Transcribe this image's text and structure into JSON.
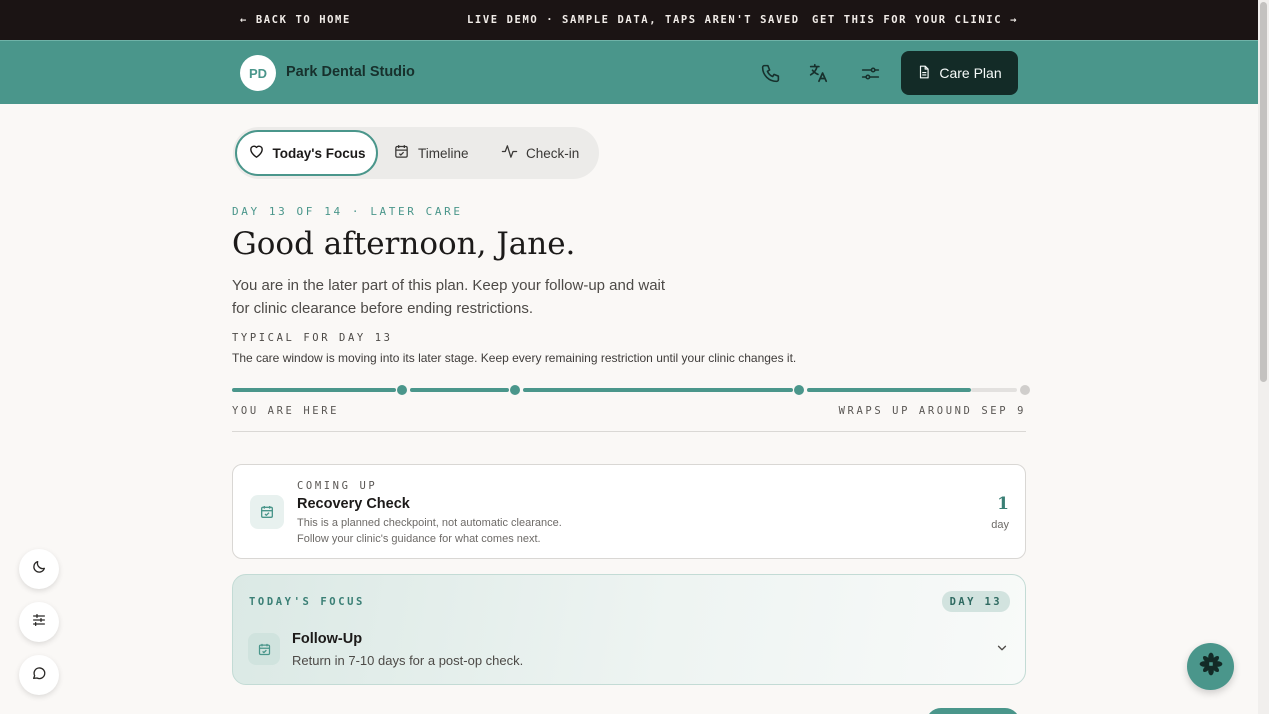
{
  "demo_bar": {
    "back_label": "← BACK TO HOME",
    "live_label": "LIVE DEMO · SAMPLE DATA, TAPS AREN'T SAVED",
    "get_label": "GET THIS FOR YOUR CLINIC →"
  },
  "header": {
    "initials": "PD",
    "clinic_name": "Park Dental Studio",
    "icons": [
      "phone-icon",
      "translate-icon",
      "settings-sliders-icon"
    ],
    "care_plan_label": "Care Plan"
  },
  "tabs": [
    {
      "label": "Today's Focus",
      "icon": "heart-icon",
      "active": true
    },
    {
      "label": "Timeline",
      "icon": "calendar-icon",
      "active": false
    },
    {
      "label": "Check-in",
      "icon": "activity-icon",
      "active": false
    }
  ],
  "greeting": {
    "eyebrow": "DAY 13 OF 14 · LATER CARE",
    "title": "Good afternoon, Jane.",
    "intro": "You are in the later part of this plan. Keep your follow-up and wait for clinic clearance before ending restrictions.",
    "typical_label": "TYPICAL FOR DAY 13",
    "typical_text": "The care window is moving into its later stage. Keep every remaining restriction until your clinic changes it."
  },
  "progress": {
    "current_day": 13,
    "total_days": 14,
    "left_label": "YOU ARE HERE",
    "right_label": "WRAPS UP AROUND SEP 9"
  },
  "coming_up": {
    "label": "COMING UP",
    "title": "Recovery Check",
    "desc_line1": "This is a planned checkpoint, not automatic clearance.",
    "desc_line2": "Follow your clinic's guidance for what comes next.",
    "count": "1",
    "unit": "day"
  },
  "focus": {
    "label": "TODAY'S FOCUS",
    "day_badge": "DAY 13",
    "title": "Follow-Up",
    "desc": "Return in 7-10 days for a post-op check."
  },
  "colors": {
    "accent": "#4a968b",
    "dark": "#1b1414",
    "button_dark": "#132b27"
  }
}
